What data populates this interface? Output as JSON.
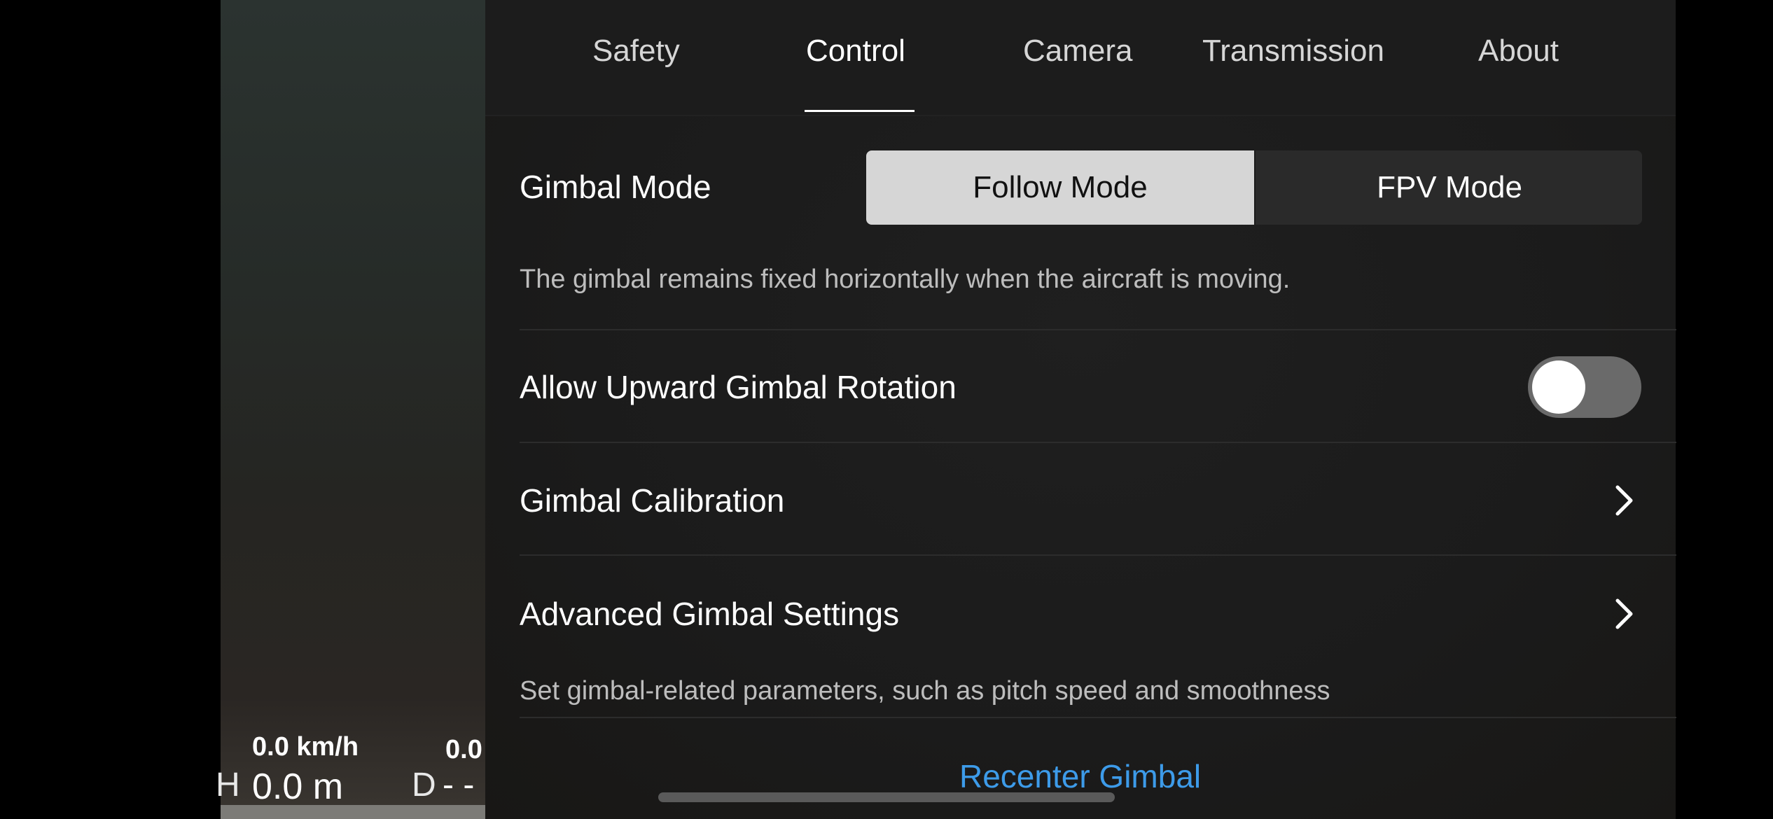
{
  "telemetry": {
    "speed": "0.0 km/h",
    "vertical_speed": "0.0",
    "height_label": "H",
    "height_value": "0.0 m",
    "distance_label": "D",
    "distance_value": "- -"
  },
  "tabs": [
    {
      "label": "Safety",
      "active": false
    },
    {
      "label": "Control",
      "active": true
    },
    {
      "label": "Camera",
      "active": false
    },
    {
      "label": "Transmission",
      "active": false
    },
    {
      "label": "About",
      "active": false
    }
  ],
  "gimbal_mode": {
    "label": "Gimbal Mode",
    "options": [
      "Follow Mode",
      "FPV Mode"
    ],
    "selected": "Follow Mode",
    "description": "The gimbal remains fixed horizontally when the aircraft is moving."
  },
  "upward_rotation": {
    "label": "Allow Upward Gimbal Rotation",
    "enabled": false
  },
  "calibration": {
    "label": "Gimbal Calibration"
  },
  "advanced": {
    "label": "Advanced Gimbal Settings",
    "description": "Set gimbal-related parameters, such as pitch speed and smoothness"
  },
  "recenter": {
    "label": "Recenter Gimbal"
  },
  "colors": {
    "accent_link": "#3d9be9",
    "selected_segment": "#d6d6d6",
    "toggle_off": "#6a6a6a"
  },
  "icons": {
    "row_chevron": "chevron-right-icon"
  }
}
